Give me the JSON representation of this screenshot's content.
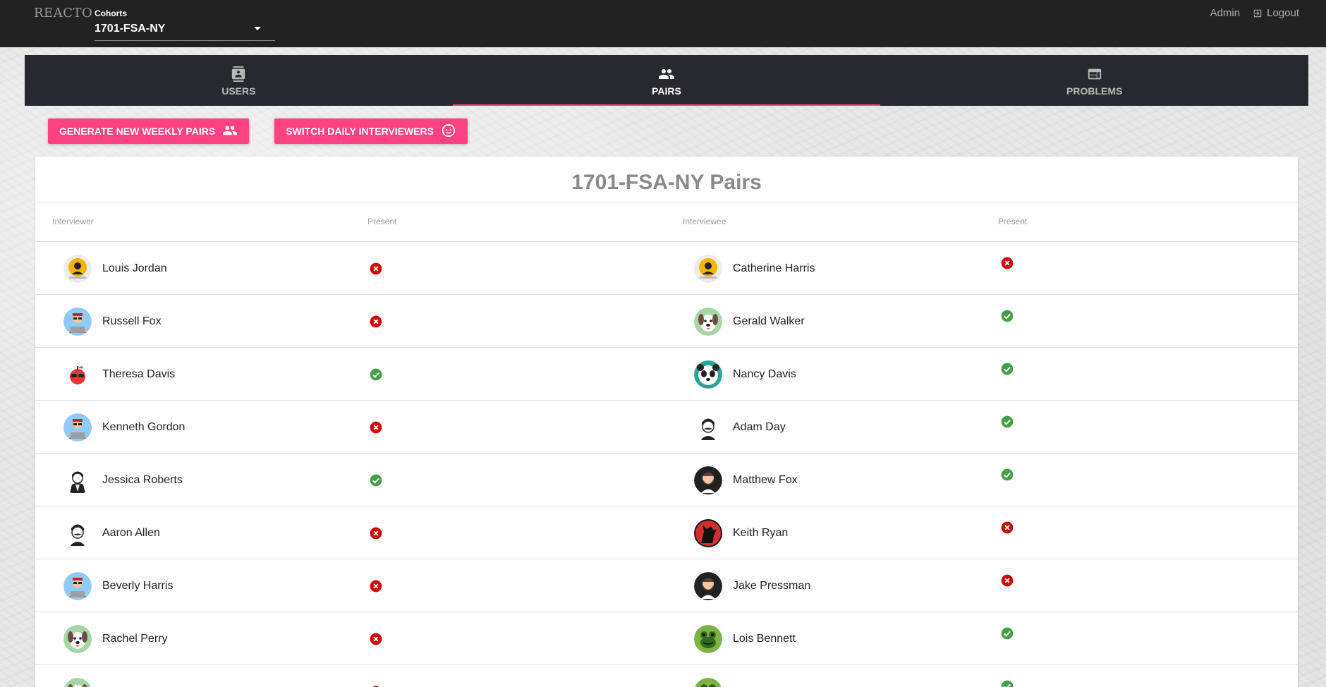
{
  "app": {
    "brand": "REACTO",
    "cohort_label": "Cohorts",
    "cohort_value": "1701-FSA-NY",
    "admin_label": "Admin",
    "logout_label": "Logout"
  },
  "tabs": [
    {
      "label": "USERS",
      "icon": "user-card-icon",
      "active": false
    },
    {
      "label": "PAIRS",
      "icon": "people-icon",
      "active": true
    },
    {
      "label": "PROBLEMS",
      "icon": "web-window-icon",
      "active": false
    }
  ],
  "actions": {
    "generate_label": "GENERATE NEW WEEKLY PAIRS",
    "switch_label": "SWITCH DAILY INTERVIEWERS"
  },
  "table": {
    "title": "1701-FSA-NY Pairs",
    "headers": [
      "Interviewer",
      "Present",
      "Interviewee",
      "Present"
    ],
    "rows": [
      {
        "interviewer": "Louis Jordan",
        "interviewer_avatar": "hacker-yellow",
        "interviewer_present": false,
        "interviewee": "Catherine Harris",
        "interviewee_avatar": "hacker-yellow",
        "interviewee_present": false
      },
      {
        "interviewer": "Russell Fox",
        "interviewer_avatar": "coder-laptop",
        "interviewer_present": false,
        "interviewee": "Gerald Walker",
        "interviewee_avatar": "dog-green",
        "interviewee_present": true
      },
      {
        "interviewer": "Theresa Davis",
        "interviewer_avatar": "apple-glasses",
        "interviewer_present": true,
        "interviewee": "Nancy Davis",
        "interviewee_avatar": "panda-teal",
        "interviewee_present": true
      },
      {
        "interviewer": "Kenneth Gordon",
        "interviewer_avatar": "coder-laptop",
        "interviewer_present": false,
        "interviewee": "Adam Day",
        "interviewee_avatar": "man-mustache",
        "interviewee_present": true
      },
      {
        "interviewer": "Jessica Roberts",
        "interviewer_avatar": "suit-man",
        "interviewer_present": true,
        "interviewee": "Matthew Fox",
        "interviewee_avatar": "bearded-dark",
        "interviewee_present": true
      },
      {
        "interviewer": "Aaron Allen",
        "interviewer_avatar": "man-mustache",
        "interviewer_present": false,
        "interviewee": "Keith Ryan",
        "interviewee_avatar": "wolf-red",
        "interviewee_present": false
      },
      {
        "interviewer": "Beverly Harris",
        "interviewer_avatar": "coder-laptop",
        "interviewer_present": false,
        "interviewee": "Jake Pressman",
        "interviewee_avatar": "bearded-dark",
        "interviewee_present": false
      },
      {
        "interviewer": "Rachel Perry",
        "interviewer_avatar": "dog-green",
        "interviewer_present": false,
        "interviewee": "Lois Bennett",
        "interviewee_avatar": "frog-green",
        "interviewee_present": true
      },
      {
        "interviewer": "",
        "interviewer_avatar": "dog-green",
        "interviewer_present": false,
        "interviewee": "",
        "interviewee_avatar": "frog-green",
        "interviewee_present": true
      }
    ]
  },
  "colors": {
    "accent": "#ff4081",
    "topbar": "#222222",
    "tabbar": "#262a30",
    "present_true": "#43a047",
    "present_false": "#d50000"
  }
}
